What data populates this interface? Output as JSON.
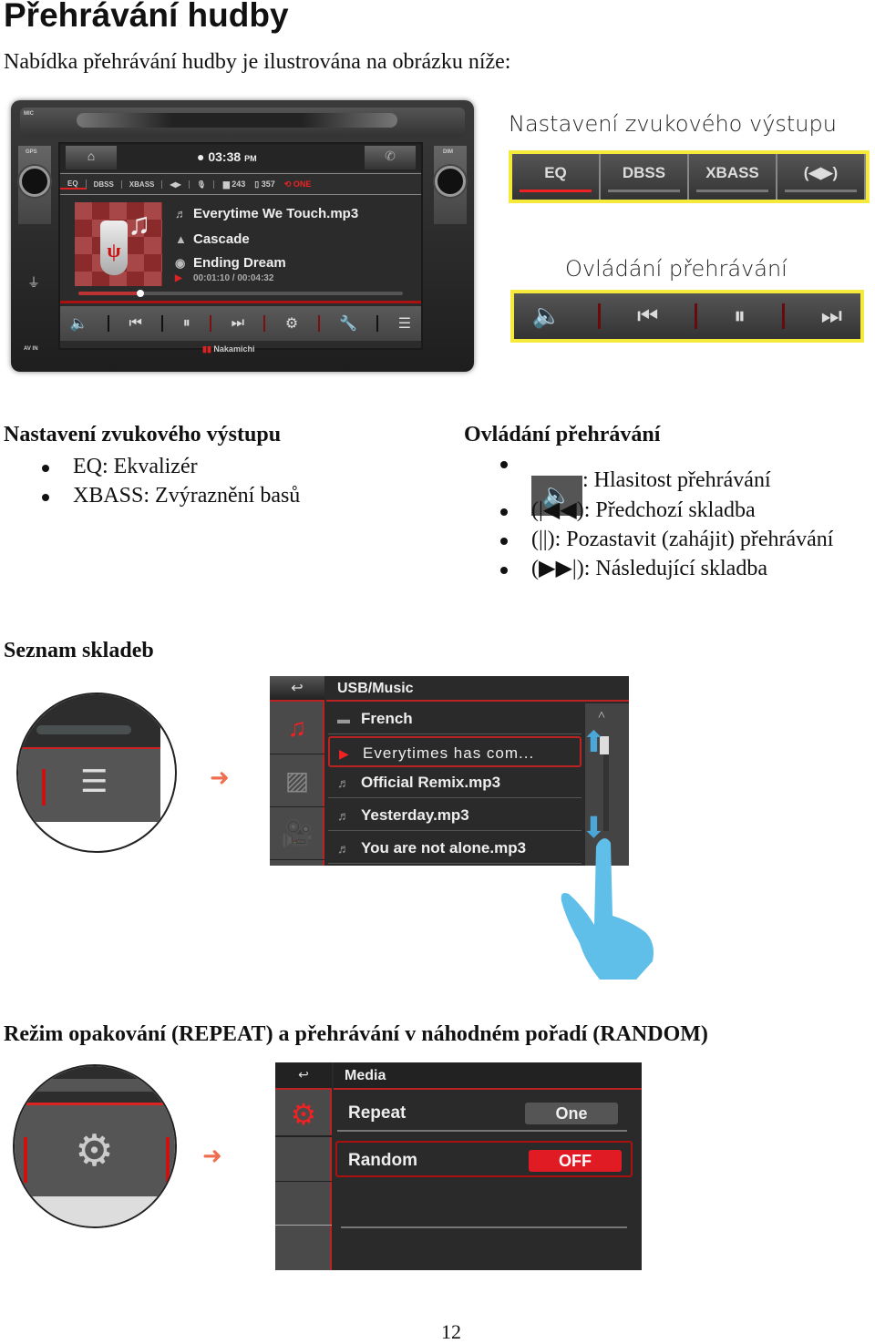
{
  "page": {
    "title": "Přehrávání hudby",
    "intro": "Nabídka přehrávání hudby je ilustrována na obrázku níže:",
    "page_number": "12"
  },
  "device": {
    "clock": "03:38",
    "clock_suffix": "PM",
    "tabs": [
      "EQ",
      "DBSS",
      "XBASS",
      "balance",
      "mic"
    ],
    "active_tab": "EQ",
    "folder_count": "243",
    "file_count": "357",
    "repeat_label": "ONE",
    "track": "Everytime We Touch.mp3",
    "artist": "Cascade",
    "album": "Ending Dream",
    "elapsed": "00:01:10",
    "total": "00:04:32",
    "time_display": "00:01:10 / 00:04:32",
    "progress_percent": 19,
    "brand": "Nakamichi",
    "labels": {
      "mic": "MIC",
      "gps": "GPS",
      "dim": "DIM",
      "av_in": "AV IN"
    },
    "icons": [
      "volume-icon",
      "previous-icon",
      "pause-icon",
      "next-icon",
      "settings-icon",
      "tools-icon",
      "list-icon"
    ]
  },
  "callouts": {
    "sound_title": "Nastavení zvukového výstupu",
    "sound_tabs": [
      "EQ",
      "DBSS",
      "XBASS",
      "(◀▶)"
    ],
    "playback_title": "Ovládání přehrávání",
    "playback_icons": [
      "volume-icon",
      "previous-icon",
      "pause-icon",
      "next-icon"
    ]
  },
  "sound_section": {
    "heading": "Nastavení zvukového výstupu",
    "items": [
      "EQ: Ekvalizér",
      "XBASS: Zvýraznění basů"
    ]
  },
  "playback_section": {
    "heading": "Ovládání přehrávání",
    "items": [
      ": Hlasitost přehrávání",
      "(|◀◀): Předchozí skladba",
      "(||): Pozastavit (zahájit) přehrávání",
      "(▶▶|): Následující skladba"
    ]
  },
  "playlist_section": {
    "heading": "Seznam skladeb",
    "path": "USB/Music",
    "rows": [
      {
        "icon": "folder-icon",
        "name": "French"
      },
      {
        "icon": "play-icon",
        "name": "Everytimes has com...",
        "selected": true
      },
      {
        "icon": "music-note-icon",
        "name": "Official Remix.mp3"
      },
      {
        "icon": "music-note-icon",
        "name": "Yesterday.mp3"
      },
      {
        "icon": "music-note-icon",
        "name": "You are not alone.mp3"
      }
    ]
  },
  "repeat_section": {
    "heading": "Režim opakování (REPEAT) a přehrávání v náhodném pořadí (RANDOM)",
    "menu_title": "Media",
    "rows": [
      {
        "label": "Repeat",
        "value": "One"
      },
      {
        "label": "Random",
        "value": "OFF"
      }
    ]
  }
}
